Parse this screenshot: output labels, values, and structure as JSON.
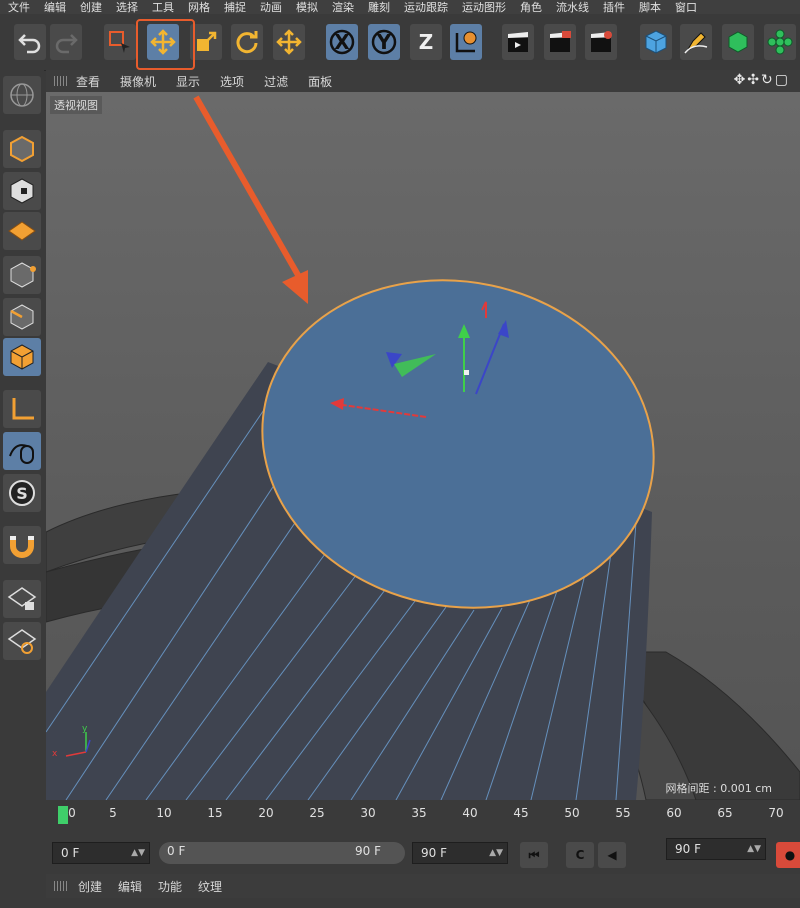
{
  "menu": [
    "文件",
    "编辑",
    "创建",
    "选择",
    "工具",
    "网格",
    "捕捉",
    "动画",
    "模拟",
    "渲染",
    "雕刻",
    "运动跟踪",
    "运动图形",
    "角色",
    "流水线",
    "插件",
    "脚本",
    "窗口"
  ],
  "toolbar": {
    "buttons": [
      {
        "name": "undo-button",
        "icon": "undo-icon"
      },
      {
        "name": "redo-button",
        "icon": "redo-icon"
      },
      {
        "name": "live-selection-button",
        "icon": "selection-icon"
      },
      {
        "name": "move-tool-button",
        "icon": "move-icon"
      },
      {
        "name": "scale-tool-button",
        "icon": "scale-icon"
      },
      {
        "name": "rotate-tool-button",
        "icon": "rotate-icon"
      },
      {
        "name": "last-tool-button",
        "icon": "move-icon"
      },
      {
        "name": "x-axis-button",
        "label": "X"
      },
      {
        "name": "y-axis-button",
        "label": "Y"
      },
      {
        "name": "z-axis-button",
        "label": "Z"
      },
      {
        "name": "coordinate-system-button",
        "icon": "world-axis-icon"
      },
      {
        "name": "render-view-button",
        "icon": "clapper-icon"
      },
      {
        "name": "render-picture-viewer-button",
        "icon": "clapper-icon"
      },
      {
        "name": "render-settings-button",
        "icon": "clapper-gear-icon"
      },
      {
        "name": "cube-button",
        "icon": "cube-icon"
      },
      {
        "name": "pen-button",
        "icon": "pen-icon"
      },
      {
        "name": "subdivision-button",
        "icon": "green-cube-icon"
      },
      {
        "name": "cloner-button",
        "icon": "cloner-icon"
      }
    ],
    "x_label": "X",
    "y_label": "Y",
    "z_label": "Z",
    "accent": "#5d7fa6",
    "highlight": "#e85c2c"
  },
  "viewport": {
    "menu": [
      "查看",
      "摄像机",
      "显示",
      "选项",
      "过滤",
      "面板"
    ],
    "label": "透视视图",
    "grid_readout": "网格间距 : 0.001 cm",
    "face_color": "#4b6f97",
    "edge_color": "#e8a24a",
    "axis_x": "x",
    "axis_y": "y"
  },
  "timeline": {
    "ticks": [
      "0",
      "5",
      "10",
      "15",
      "20",
      "25",
      "30",
      "35",
      "40",
      "45",
      "50",
      "55",
      "60",
      "65",
      "70"
    ],
    "current_frame": 0
  },
  "transport": {
    "start": "0 F",
    "slider_left": "0 F",
    "slider_right": "90 F",
    "end": "90 F",
    "popup": "90 F"
  },
  "bottom_menu": [
    "创建",
    "编辑",
    "功能",
    "纹理"
  ]
}
